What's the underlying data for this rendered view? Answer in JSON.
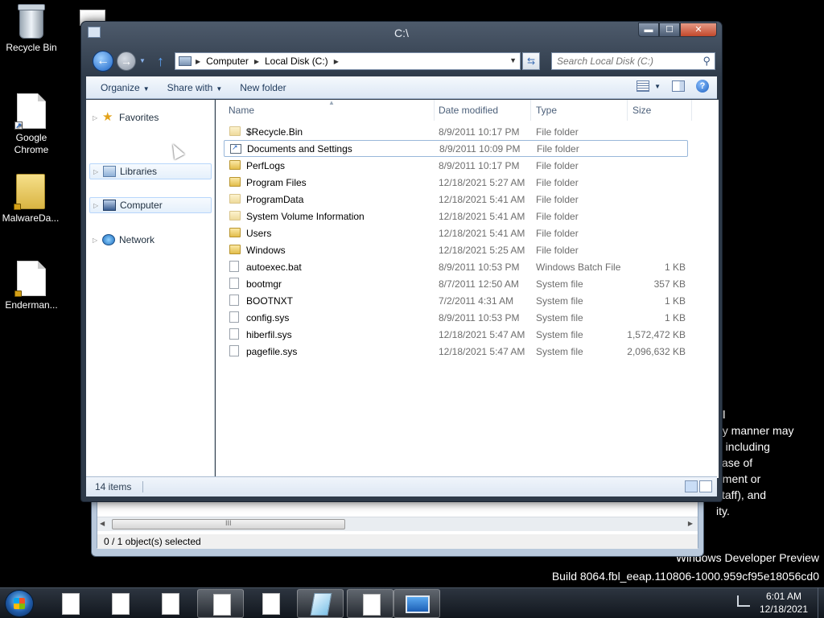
{
  "desktop": {
    "icons": [
      {
        "label": "Recycle Bin"
      },
      {
        "label": "Google Chrome"
      },
      {
        "label": "MalwareDa..."
      },
      {
        "label": "Enderman..."
      }
    ],
    "side_text": [
      "al",
      "ny manner may",
      "d including",
      "case of",
      "nment or",
      "staff), and",
      "ity."
    ],
    "watermark_line1": "Windows Developer Preview",
    "watermark_line2": "Build 8064.fbl_eeap.110806-1000.959cf95e18056cd0"
  },
  "bg_window": {
    "scroll_grip": "III",
    "status": "0 / 1 object(s) selected"
  },
  "window": {
    "title": "C:\\",
    "controls": {
      "minimize": "▬",
      "maximize": "☐",
      "close": "✕"
    },
    "breadcrumb": [
      "Computer",
      "Local Disk (C:)"
    ],
    "search_placeholder": "Search Local Disk (C:)",
    "toolbar": {
      "organize": "Organize",
      "share_with": "Share with",
      "new_folder": "New folder"
    },
    "nav": {
      "favorites": "Favorites",
      "libraries": "Libraries",
      "computer": "Computer",
      "network": "Network"
    },
    "columns": {
      "name": "Name",
      "date": "Date modified",
      "type": "Type",
      "size": "Size"
    },
    "files": [
      {
        "name": "$Recycle.Bin",
        "date": "8/9/2011 10:17 PM",
        "type": "File folder",
        "size": "",
        "kind": "folder-hidden"
      },
      {
        "name": "Documents and Settings",
        "date": "8/9/2011 10:09 PM",
        "type": "File folder",
        "size": "",
        "kind": "shortcut"
      },
      {
        "name": "PerfLogs",
        "date": "8/9/2011 10:17 PM",
        "type": "File folder",
        "size": "",
        "kind": "folder"
      },
      {
        "name": "Program Files",
        "date": "12/18/2021 5:27 AM",
        "type": "File folder",
        "size": "",
        "kind": "folder"
      },
      {
        "name": "ProgramData",
        "date": "12/18/2021 5:41 AM",
        "type": "File folder",
        "size": "",
        "kind": "folder-hidden"
      },
      {
        "name": "System Volume Information",
        "date": "12/18/2021 5:41 AM",
        "type": "File folder",
        "size": "",
        "kind": "folder-hidden"
      },
      {
        "name": "Users",
        "date": "12/18/2021 5:41 AM",
        "type": "File folder",
        "size": "",
        "kind": "folder"
      },
      {
        "name": "Windows",
        "date": "12/18/2021 5:25 AM",
        "type": "File folder",
        "size": "",
        "kind": "folder"
      },
      {
        "name": "autoexec.bat",
        "date": "8/9/2011 10:53 PM",
        "type": "Windows Batch File",
        "size": "1 KB",
        "kind": "file"
      },
      {
        "name": "bootmgr",
        "date": "8/7/2011 12:50 AM",
        "type": "System file",
        "size": "357 KB",
        "kind": "file"
      },
      {
        "name": "BOOTNXT",
        "date": "7/2/2011 4:31 AM",
        "type": "System file",
        "size": "1 KB",
        "kind": "file"
      },
      {
        "name": "config.sys",
        "date": "8/9/2011 10:53 PM",
        "type": "System file",
        "size": "1 KB",
        "kind": "file"
      },
      {
        "name": "hiberfil.sys",
        "date": "12/18/2021 5:47 AM",
        "type": "System file",
        "size": "1,572,472 KB",
        "kind": "file"
      },
      {
        "name": "pagefile.sys",
        "date": "12/18/2021 5:47 AM",
        "type": "System file",
        "size": "2,096,632 KB",
        "kind": "file"
      }
    ],
    "status": "14 items"
  },
  "taskbar": {
    "time": "6:01 AM",
    "date": "12/18/2021"
  }
}
